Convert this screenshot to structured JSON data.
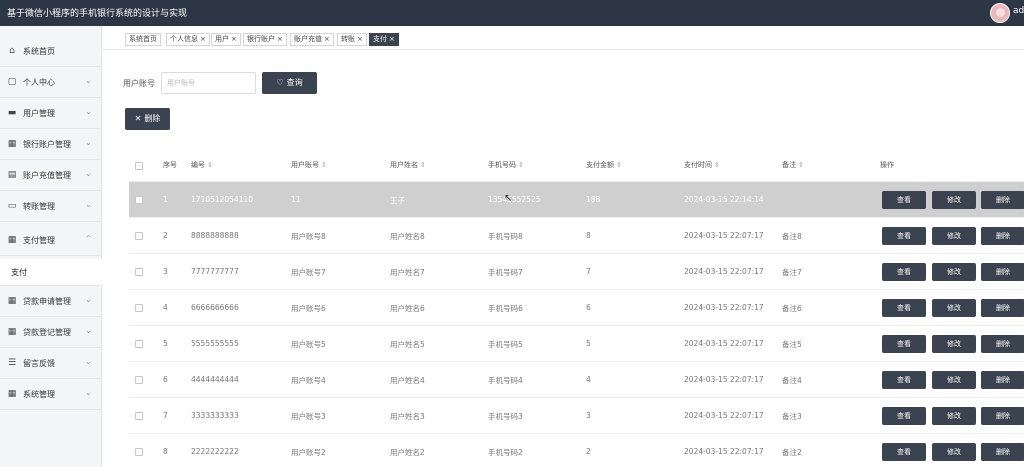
{
  "header": {
    "title": "基于微信小程序的手机银行系统的设计与实现",
    "username": "ad"
  },
  "sidebar": {
    "items": [
      {
        "label": "系统首页",
        "icon": "home-icon",
        "glyph": "⌂",
        "chevron": ""
      },
      {
        "label": "个人中心",
        "icon": "person-icon",
        "glyph": "▢",
        "chevron": "⌄"
      },
      {
        "label": "用户管理",
        "icon": "users-icon",
        "glyph": "▬",
        "chevron": "⌄"
      },
      {
        "label": "银行账户管理",
        "icon": "grid-icon",
        "glyph": "▦",
        "chevron": "⌄"
      },
      {
        "label": "账户充值管理",
        "icon": "document-icon",
        "glyph": "▤",
        "chevron": "⌄"
      },
      {
        "label": "转账管理",
        "icon": "transfer-icon",
        "glyph": "▭",
        "chevron": "⌄"
      },
      {
        "label": "支付管理",
        "icon": "grid-icon",
        "glyph": "▦",
        "chevron": "⌃"
      },
      {
        "label": "贷款申请管理",
        "icon": "grid-icon",
        "glyph": "▦",
        "chevron": "⌄"
      },
      {
        "label": "贷款登记管理",
        "icon": "grid-icon",
        "glyph": "▦",
        "chevron": "⌄"
      },
      {
        "label": "留言反馈",
        "icon": "message-icon",
        "glyph": "☰",
        "chevron": "⌄"
      },
      {
        "label": "系统管理",
        "icon": "grid-icon",
        "glyph": "▦",
        "chevron": "⌄"
      }
    ],
    "submenu_label": "支付"
  },
  "tags": [
    {
      "label": "系统首页",
      "close": ""
    },
    {
      "label": "个人信息",
      "close": "×"
    },
    {
      "label": "用户",
      "close": "×"
    },
    {
      "label": "银行账户",
      "close": "×"
    },
    {
      "label": "账户充值",
      "close": "×"
    },
    {
      "label": "转账",
      "close": "×"
    },
    {
      "label": "支付",
      "close": "×"
    }
  ],
  "search": {
    "label": "用户账号",
    "placeholder": "用户账号",
    "value": "",
    "button_label": "查询",
    "button_icon": "♡"
  },
  "toolbar": {
    "delete_label": "删除",
    "delete_icon": "✕"
  },
  "table": {
    "columns": [
      "序号",
      "编号",
      "用户账号",
      "用户姓名",
      "手机号码",
      "支付金额",
      "支付时间",
      "备注",
      "操作"
    ],
    "sort_glyph": "⇕",
    "actions": [
      "查看",
      "修改",
      "删除"
    ],
    "rows": [
      {
        "index": "1",
        "code": "1710512054110",
        "account": "11",
        "name": "王子",
        "phone": "13545552525",
        "amount": "188",
        "time": "2024-03-15 22:14:14",
        "note": "",
        "highlighted": true
      },
      {
        "index": "2",
        "code": "8888888888",
        "account": "用户账号8",
        "name": "用户姓名8",
        "phone": "手机号码8",
        "amount": "8",
        "time": "2024-03-15 22:07:17",
        "note": "备注8",
        "highlighted": false
      },
      {
        "index": "3",
        "code": "7777777777",
        "account": "用户账号7",
        "name": "用户姓名7",
        "phone": "手机号码7",
        "amount": "7",
        "time": "2024-03-15 22:07:17",
        "note": "备注7",
        "highlighted": false
      },
      {
        "index": "4",
        "code": "6666666666",
        "account": "用户账号6",
        "name": "用户姓名6",
        "phone": "手机号码6",
        "amount": "6",
        "time": "2024-03-15 22:07:17",
        "note": "备注6",
        "highlighted": false
      },
      {
        "index": "5",
        "code": "5555555555",
        "account": "用户账号5",
        "name": "用户姓名5",
        "phone": "手机号码5",
        "amount": "5",
        "time": "2024-03-15 22:07:17",
        "note": "备注5",
        "highlighted": false
      },
      {
        "index": "6",
        "code": "4444444444",
        "account": "用户账号4",
        "name": "用户姓名4",
        "phone": "手机号码4",
        "amount": "4",
        "time": "2024-03-15 22:07:17",
        "note": "备注4",
        "highlighted": false
      },
      {
        "index": "7",
        "code": "3333333333",
        "account": "用户账号3",
        "name": "用户姓名3",
        "phone": "手机号码3",
        "amount": "3",
        "time": "2024-03-15 22:07:17",
        "note": "备注3",
        "highlighted": false
      },
      {
        "index": "8",
        "code": "2222222222",
        "account": "用户账号2",
        "name": "用户姓名2",
        "phone": "手机号码2",
        "amount": "2",
        "time": "2024-03-15 22:07:17",
        "note": "备注2",
        "highlighted": false
      }
    ]
  },
  "cursor": {
    "icon": "mouse-pointer-icon",
    "glyph": "↖"
  },
  "colors": {
    "topbar": "#2c3644",
    "sidebar": "#f4f5f7",
    "button": "#3b4350",
    "row_highlight": "#cfcfcf"
  }
}
